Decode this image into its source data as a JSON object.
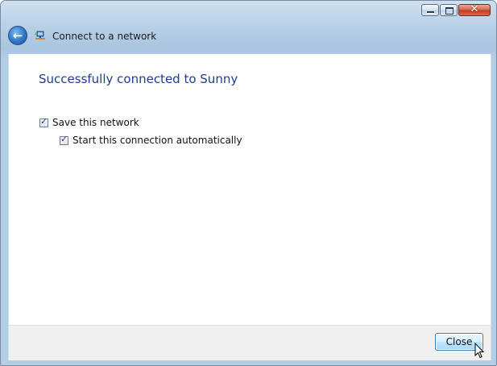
{
  "window": {
    "title": "Connect to a network"
  },
  "caption_buttons": {
    "minimize": "minimize-icon",
    "maximize": "maximize-icon",
    "close": "close-icon",
    "close_glyph": "✕",
    "close_color": "#c0391f"
  },
  "header": {
    "back_icon": "back-arrow-icon",
    "back_glyph": "←",
    "network_icon": "network-icon"
  },
  "content": {
    "heading": "Successfully connected to Sunny",
    "heading_color": "#1e3d8f",
    "checkboxes": [
      {
        "label": "Save this network",
        "checked": true
      },
      {
        "label": "Start this connection automatically",
        "checked": true
      }
    ],
    "check_glyph": "✓"
  },
  "footer": {
    "close_label": "Close"
  },
  "cursor": {
    "icon": "mouse-pointer-icon"
  }
}
